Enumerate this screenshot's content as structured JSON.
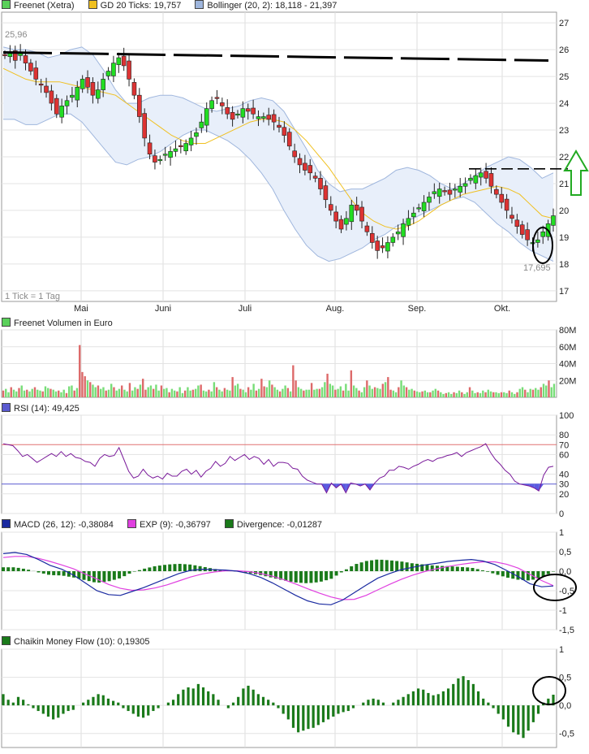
{
  "legends": {
    "price": [
      {
        "label": "Freenet (Xetra)",
        "color": "#5ad05a"
      },
      {
        "label": "GD 20 Ticks: 19,757",
        "color": "#f0c020"
      },
      {
        "label": "Bollinger (20, 2): 18,118 - 21,397",
        "color": "#9fb6dd"
      }
    ],
    "volume": {
      "label": "Freenet Volumen in Euro",
      "color": "#5ad05a"
    },
    "rsi": {
      "label": "RSI (14): 49,425",
      "color": "#5a5ad0"
    },
    "macd": [
      {
        "label": "MACD (26, 12): -0,38084",
        "color": "#1a2aa0"
      },
      {
        "label": "EXP (9): -0,36797",
        "color": "#e040e0"
      },
      {
        "label": "Divergence: -0,01287",
        "color": "#1a7a1a"
      }
    ],
    "cmf": {
      "label": "Chaikin Money Flow (10): 0,19305",
      "color": "#1a7a1a"
    }
  },
  "annotations": {
    "high_label": "25,96",
    "low_label": "17,695",
    "tick_note": "1 Tick = 1 Tag"
  },
  "colors": {
    "up_candle": "#22dd22",
    "down_candle": "#dd3333",
    "band_fill": "#e8effa",
    "band_line": "#9fb6dd",
    "ma_line": "#f0c020",
    "vol_up": "#77dd77",
    "vol_down": "#dd6a6a",
    "rsi_line": "#7a1a9a",
    "macd_line": "#1a2aa0",
    "exp_line": "#e040e0",
    "bar_green": "#1a7a1a",
    "resistance": "#000000",
    "arrow": "#22aa22"
  },
  "chart_data": [
    {
      "type": "candlestick",
      "name": "Freenet (Xetra)",
      "x_labels": [
        "Mai",
        "Juni",
        "Juli",
        "Aug.",
        "Sep.",
        "Okt."
      ],
      "ylim": [
        16.6,
        27.4
      ],
      "yticks": [
        17,
        18,
        19,
        20,
        21,
        22,
        23,
        24,
        25,
        26,
        27
      ],
      "close_path": [
        25.8,
        25.9,
        25.6,
        25.9,
        25.5,
        25.2,
        24.9,
        24.7,
        24.4,
        24.0,
        23.6,
        23.9,
        24.1,
        24.3,
        24.6,
        24.9,
        24.6,
        24.3,
        24.5,
        24.9,
        25.2,
        25.5,
        25.7,
        25.4,
        24.9,
        24.3,
        23.5,
        22.7,
        22.1,
        21.8,
        21.9,
        22.1,
        22.2,
        22.3,
        22.4,
        22.5,
        22.7,
        22.9,
        23.3,
        23.8,
        24.1,
        24.2,
        23.9,
        23.6,
        23.4,
        23.6,
        23.8,
        23.7,
        23.6,
        23.5,
        23.5,
        23.4,
        23.3,
        23.1,
        22.8,
        22.4,
        22.0,
        21.7,
        21.5,
        21.4,
        21.2,
        20.8,
        20.4,
        20.0,
        19.6,
        19.3,
        19.7,
        20.2,
        20.0,
        19.6,
        19.2,
        18.8,
        18.5,
        18.6,
        18.8,
        19.0,
        19.2,
        19.5,
        19.7,
        19.9,
        20.1,
        20.3,
        20.5,
        20.7,
        20.8,
        20.7,
        20.6,
        20.8,
        20.9,
        21.0,
        21.2,
        21.3,
        21.4,
        21.2,
        20.9,
        20.6,
        20.3,
        20.0,
        19.7,
        19.4,
        19.1,
        18.9,
        18.8,
        18.9,
        19.2,
        19.5,
        19.8
      ],
      "ma20": [
        25.3,
        25.1,
        24.9,
        24.8,
        24.8,
        24.8,
        24.7,
        24.6,
        24.5,
        24.4,
        24.3,
        24.0,
        23.7,
        23.4,
        23.1,
        22.8,
        22.6,
        22.5,
        22.5,
        22.7,
        22.9,
        23.1,
        23.3,
        23.4,
        23.4,
        23.3,
        23.0,
        22.6,
        22.1,
        21.6,
        21.0,
        20.4,
        19.9,
        19.6,
        19.4,
        19.3,
        19.4,
        19.6,
        19.9,
        20.2,
        20.4,
        20.6,
        20.7,
        20.8,
        20.9,
        20.8,
        20.6,
        20.2,
        19.8,
        19.7
      ],
      "bb_upper": [
        26.1,
        26.0,
        26.0,
        25.9,
        25.7,
        25.8,
        26.0,
        26.1,
        25.8,
        25.2,
        24.5,
        24.0,
        24.0,
        24.2,
        24.3,
        24.3,
        24.2,
        24.0,
        23.8,
        23.7,
        23.8,
        23.9,
        24.1,
        24.2,
        24.1,
        23.7,
        23.0,
        22.3,
        21.5,
        21.0,
        20.7,
        20.8,
        20.8,
        21.0,
        21.2,
        21.5,
        21.6,
        21.5,
        21.3,
        21.0,
        20.8,
        21.0,
        21.3,
        21.6,
        21.8,
        22.0,
        21.9,
        21.6,
        21.2,
        21.4
      ],
      "bb_lower": [
        23.4,
        23.4,
        23.2,
        23.2,
        23.4,
        23.6,
        23.6,
        23.3,
        22.8,
        22.3,
        21.8,
        21.7,
        21.9,
        22.0,
        22.2,
        22.5,
        22.8,
        23.0,
        23.0,
        22.8,
        22.6,
        22.3,
        21.9,
        21.4,
        20.8,
        20.0,
        19.3,
        18.7,
        18.3,
        18.1,
        18.2,
        18.4,
        18.6,
        18.9,
        19.1,
        19.4,
        19.6,
        19.8,
        20.0,
        20.2,
        20.4,
        20.5,
        20.3,
        19.9,
        19.5,
        19.2,
        18.8,
        18.5,
        18.3,
        18.1
      ],
      "resistance_levels": [
        25.96,
        21.55
      ]
    },
    {
      "type": "bar",
      "name": "Freenet Volumen in Euro",
      "ylim": [
        0,
        80
      ],
      "yticks_labels": [
        "20M",
        "40M",
        "60M",
        "80M"
      ],
      "values_m": [
        8,
        10,
        6,
        12,
        9,
        7,
        11,
        14,
        8,
        9,
        7,
        10,
        12,
        9,
        8,
        7,
        13,
        11,
        10,
        9,
        7,
        8,
        6,
        9,
        5,
        13,
        14,
        8,
        11,
        62,
        30,
        25,
        20,
        18,
        15,
        12,
        14,
        10,
        12,
        8,
        9,
        16,
        12,
        8,
        10,
        14,
        9,
        7,
        17,
        8,
        12,
        10,
        15,
        22,
        9,
        12,
        14,
        10,
        15,
        8,
        14,
        10,
        11,
        6,
        10,
        8,
        7,
        12,
        5,
        8,
        12,
        8,
        9,
        10,
        14,
        15,
        8,
        7,
        9,
        7,
        18,
        12,
        9,
        7,
        11,
        9,
        8,
        24,
        14,
        16,
        10,
        9,
        6,
        12,
        9,
        16,
        8,
        10,
        22,
        13,
        12,
        20,
        15,
        12,
        9,
        7,
        10,
        14,
        11,
        7,
        38,
        20,
        12,
        10,
        8,
        9,
        9,
        17,
        9,
        10,
        10,
        12,
        18,
        28,
        16,
        14,
        9,
        10,
        13,
        8,
        16,
        8,
        32,
        14,
        11,
        8,
        6,
        12,
        20,
        14,
        10,
        12,
        11,
        10,
        16,
        18,
        24,
        9,
        8,
        6,
        12,
        20,
        14,
        12,
        9,
        10,
        8,
        7,
        6,
        7,
        8,
        6,
        6,
        8,
        10,
        8,
        6,
        4,
        5,
        6,
        4,
        6,
        5,
        8,
        6,
        4,
        6,
        12,
        8,
        5,
        6,
        5,
        8,
        6,
        9,
        7,
        6,
        6,
        5,
        6,
        6,
        5,
        8,
        6,
        4,
        6,
        10,
        12,
        9,
        6,
        10,
        9,
        11,
        9,
        12,
        16,
        14,
        20,
        12,
        16
      ]
    },
    {
      "type": "line",
      "name": "RSI (14)",
      "ylim": [
        0,
        100
      ],
      "yticks": [
        0,
        20,
        40,
        60,
        80,
        100
      ],
      "levels": [
        30,
        70
      ],
      "values": [
        71,
        70,
        69,
        64,
        58,
        60,
        56,
        52,
        55,
        58,
        61,
        58,
        63,
        58,
        61,
        57,
        56,
        53,
        52,
        48,
        56,
        60,
        58,
        59,
        67,
        55,
        43,
        36,
        38,
        45,
        39,
        36,
        38,
        35,
        41,
        38,
        38,
        43,
        45,
        40,
        44,
        37,
        43,
        46,
        53,
        48,
        51,
        58,
        54,
        57,
        60,
        55,
        58,
        56,
        50,
        55,
        48,
        52,
        52,
        51,
        46,
        45,
        38,
        34,
        32,
        30,
        30,
        21,
        31,
        26,
        30,
        21,
        31,
        30,
        28,
        30,
        24,
        31,
        36,
        38,
        44,
        44,
        48,
        47,
        45,
        48,
        50,
        53,
        55,
        53,
        56,
        57,
        59,
        60,
        62,
        58,
        62,
        64,
        66,
        68,
        71,
        62,
        55,
        50,
        44,
        40,
        33,
        30,
        29,
        28,
        26,
        23,
        39,
        47,
        48
      ]
    },
    {
      "type": "line",
      "name": "MACD (26, 12)",
      "ylim": [
        -1.5,
        1.0
      ],
      "yticks": [
        -1.5,
        -1.0,
        -0.5,
        0,
        0.5,
        1.0
      ],
      "macd": [
        0.45,
        0.48,
        0.43,
        0.3,
        0.15,
        0.05,
        -0.1,
        -0.3,
        -0.5,
        -0.6,
        -0.62,
        -0.52,
        -0.42,
        -0.3,
        -0.18,
        -0.06,
        0.02,
        0.05,
        0.04,
        0.03,
        0.0,
        -0.06,
        -0.16,
        -0.3,
        -0.46,
        -0.62,
        -0.76,
        -0.84,
        -0.86,
        -0.74,
        -0.55,
        -0.36,
        -0.18,
        -0.06,
        0.04,
        0.1,
        0.16,
        0.2,
        0.25,
        0.28,
        0.3,
        0.26,
        0.17,
        0.02,
        -0.14,
        -0.32,
        -0.4,
        -0.38
      ],
      "exp": [
        0.35,
        0.38,
        0.38,
        0.33,
        0.25,
        0.16,
        0.06,
        -0.07,
        -0.2,
        -0.34,
        -0.44,
        -0.49,
        -0.48,
        -0.43,
        -0.35,
        -0.25,
        -0.15,
        -0.07,
        -0.02,
        0.01,
        0.01,
        -0.01,
        -0.06,
        -0.13,
        -0.22,
        -0.33,
        -0.45,
        -0.56,
        -0.66,
        -0.73,
        -0.72,
        -0.62,
        -0.48,
        -0.34,
        -0.21,
        -0.1,
        -0.01,
        0.06,
        0.12,
        0.17,
        0.21,
        0.24,
        0.24,
        0.18,
        0.08,
        -0.08,
        -0.24,
        -0.37
      ],
      "divergence": [
        0.1,
        0.1,
        0.05,
        -0.03,
        -0.1,
        -0.11,
        -0.16,
        -0.23,
        -0.3,
        -0.26,
        -0.18,
        -0.03,
        0.06,
        0.13,
        0.17,
        0.19,
        0.17,
        0.12,
        0.06,
        0.02,
        -0.01,
        -0.05,
        -0.1,
        -0.17,
        -0.24,
        -0.29,
        -0.31,
        -0.28,
        -0.2,
        -0.01,
        0.17,
        0.26,
        0.3,
        0.28,
        0.25,
        0.2,
        0.17,
        0.14,
        0.13,
        0.11,
        0.09,
        0.02,
        -0.07,
        -0.16,
        -0.22,
        -0.24,
        -0.16,
        -0.01
      ]
    },
    {
      "type": "bar",
      "name": "Chaikin Money Flow (10)",
      "ylim": [
        -0.75,
        1.0
      ],
      "yticks": [
        -0.5,
        0,
        0.5,
        1.0
      ],
      "values": [
        0.2,
        0.1,
        0.05,
        0.15,
        0.1,
        0.02,
        -0.05,
        -0.1,
        -0.15,
        -0.2,
        -0.25,
        -0.22,
        -0.15,
        -0.1,
        -0.08,
        0.0,
        0.05,
        0.1,
        0.15,
        0.2,
        0.18,
        0.12,
        0.08,
        0.05,
        -0.05,
        -0.1,
        -0.15,
        -0.2,
        -0.22,
        -0.18,
        -0.1,
        -0.05,
        0.0,
        0.05,
        0.1,
        0.2,
        0.28,
        0.32,
        0.3,
        0.38,
        0.32,
        0.25,
        0.2,
        0.1,
        0.0,
        -0.05,
        0.05,
        0.15,
        0.3,
        0.35,
        0.28,
        0.2,
        0.15,
        0.1,
        0.05,
        -0.05,
        -0.15,
        -0.25,
        -0.4,
        -0.48,
        -0.45,
        -0.42,
        -0.4,
        -0.35,
        -0.3,
        -0.25,
        -0.2,
        -0.15,
        -0.12,
        -0.1,
        -0.05,
        0.0,
        0.05,
        0.1,
        0.12,
        0.1,
        0.05,
        0.0,
        0.05,
        0.1,
        0.15,
        0.2,
        0.25,
        0.3,
        0.28,
        0.22,
        0.18,
        0.2,
        0.25,
        0.3,
        0.38,
        0.48,
        0.52,
        0.45,
        0.38,
        0.25,
        0.12,
        0.05,
        -0.05,
        -0.15,
        -0.25,
        -0.38,
        -0.48,
        -0.52,
        -0.58,
        -0.45,
        -0.3,
        -0.15,
        0.05,
        0.12,
        0.19
      ]
    }
  ]
}
